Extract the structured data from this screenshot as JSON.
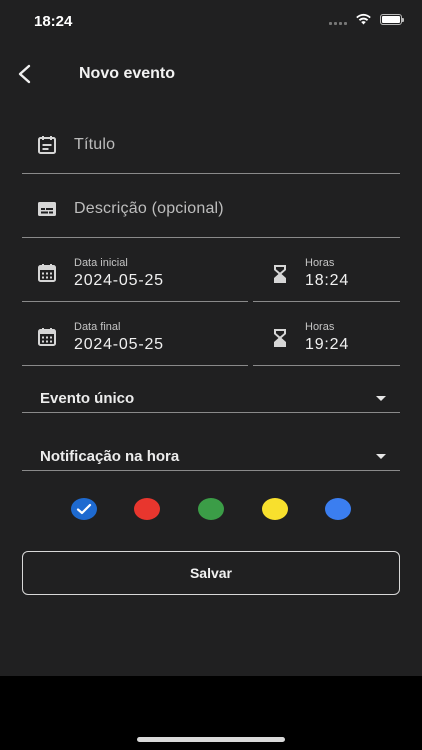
{
  "status": {
    "time": "18:24"
  },
  "header": {
    "title": "Novo evento"
  },
  "form": {
    "title_placeholder": "Título",
    "description_placeholder": "Descrição (opcional)",
    "start": {
      "date_label": "Data inicial",
      "date_value": "2024-05-25",
      "time_label": "Horas",
      "time_value": "18:24"
    },
    "end": {
      "date_label": "Data final",
      "date_value": "2024-05-25",
      "time_label": "Horas",
      "time_value": "19:24"
    },
    "recurrence": "Evento único",
    "notification": "Notificação na hora"
  },
  "colors": {
    "options": [
      "#1e6ad0",
      "#e8362e",
      "#3b9d47",
      "#f8e02d",
      "#3b7ef0"
    ],
    "selected_index": 0
  },
  "actions": {
    "save_label": "Salvar"
  }
}
